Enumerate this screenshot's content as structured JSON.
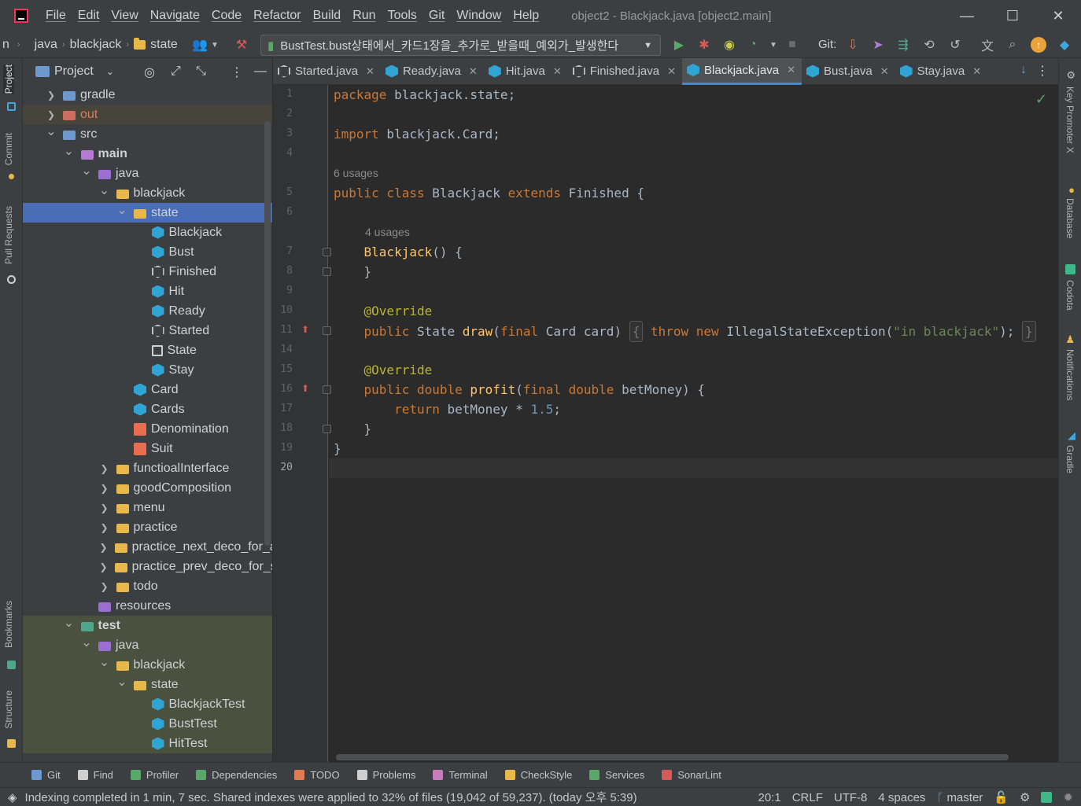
{
  "window": {
    "menu": [
      "File",
      "Edit",
      "View",
      "Navigate",
      "Code",
      "Refactor",
      "Build",
      "Run",
      "Tools",
      "Git",
      "Window",
      "Help"
    ],
    "title": "object2 - Blackjack.java [object2.main]",
    "minimize": "—",
    "maximize": "☐",
    "close": "✕"
  },
  "navbar": {
    "crumbs": [
      "n",
      "java",
      "blackjack",
      "state"
    ],
    "run_config": "BustTest.bust상태에서_카드1장을_추가로_받을때_예외가_발생한다",
    "git_label": "Git:"
  },
  "left_strip": {
    "tabs": [
      "Project",
      "Commit",
      "Pull Requests",
      "Bookmarks",
      "Structure"
    ]
  },
  "right_strip": {
    "tabs": [
      "Key Promoter X",
      "Database",
      "Codota",
      "Notifications",
      "Gradle"
    ]
  },
  "project_panel": {
    "title": "Project",
    "tree": [
      {
        "label": "gradle",
        "depth": 0,
        "arrow": "›",
        "icon": "folder-blue"
      },
      {
        "label": "out",
        "depth": 0,
        "arrow": "›",
        "icon": "folder-red",
        "state": "excluded"
      },
      {
        "label": "src",
        "depth": 0,
        "arrow": "⌄",
        "icon": "folder-blue"
      },
      {
        "label": "main",
        "depth": 1,
        "arrow": "⌄",
        "icon": "folder-main"
      },
      {
        "label": "java",
        "depth": 2,
        "arrow": "⌄",
        "icon": "folder-purple"
      },
      {
        "label": "blackjack",
        "depth": 3,
        "arrow": "⌄",
        "icon": "folder"
      },
      {
        "label": "state",
        "depth": 4,
        "arrow": "⌄",
        "icon": "folder",
        "state": "selected"
      },
      {
        "label": "Blackjack",
        "depth": 5,
        "arrow": "",
        "icon": "class"
      },
      {
        "label": "Bust",
        "depth": 5,
        "arrow": "",
        "icon": "class"
      },
      {
        "label": "Finished",
        "depth": 5,
        "arrow": "",
        "icon": "abstract"
      },
      {
        "label": "Hit",
        "depth": 5,
        "arrow": "",
        "icon": "class"
      },
      {
        "label": "Ready",
        "depth": 5,
        "arrow": "",
        "icon": "class"
      },
      {
        "label": "Started",
        "depth": 5,
        "arrow": "",
        "icon": "abstract"
      },
      {
        "label": "State",
        "depth": 5,
        "arrow": "",
        "icon": "interface"
      },
      {
        "label": "Stay",
        "depth": 5,
        "arrow": "",
        "icon": "class"
      },
      {
        "label": "Card",
        "depth": 4,
        "arrow": "",
        "icon": "class"
      },
      {
        "label": "Cards",
        "depth": 4,
        "arrow": "",
        "icon": "class"
      },
      {
        "label": "Denomination",
        "depth": 4,
        "arrow": "",
        "icon": "enum"
      },
      {
        "label": "Suit",
        "depth": 4,
        "arrow": "",
        "icon": "enum"
      },
      {
        "label": "functioalInterface",
        "depth": 3,
        "arrow": "›",
        "icon": "folder"
      },
      {
        "label": "goodComposition",
        "depth": 3,
        "arrow": "›",
        "icon": "folder"
      },
      {
        "label": "menu",
        "depth": 3,
        "arrow": "›",
        "icon": "folder"
      },
      {
        "label": "practice",
        "depth": 3,
        "arrow": "›",
        "icon": "folder"
      },
      {
        "label": "practice_next_deco_for_ad",
        "depth": 3,
        "arrow": "›",
        "icon": "folder"
      },
      {
        "label": "practice_prev_deco_for_se",
        "depth": 3,
        "arrow": "›",
        "icon": "folder"
      },
      {
        "label": "todo",
        "depth": 3,
        "arrow": "›",
        "icon": "folder"
      },
      {
        "label": "resources",
        "depth": 2,
        "arrow": "",
        "icon": "folder-purple"
      },
      {
        "label": "test",
        "depth": 1,
        "arrow": "⌄",
        "icon": "folder-green",
        "state": "test"
      },
      {
        "label": "java",
        "depth": 2,
        "arrow": "⌄",
        "icon": "folder-purple",
        "state": "test"
      },
      {
        "label": "blackjack",
        "depth": 3,
        "arrow": "⌄",
        "icon": "folder",
        "state": "test"
      },
      {
        "label": "state",
        "depth": 4,
        "arrow": "⌄",
        "icon": "folder",
        "state": "test"
      },
      {
        "label": "BlackjackTest",
        "depth": 5,
        "arrow": "",
        "icon": "class",
        "state": "test"
      },
      {
        "label": "BustTest",
        "depth": 5,
        "arrow": "",
        "icon": "class",
        "state": "test"
      },
      {
        "label": "HitTest",
        "depth": 5,
        "arrow": "",
        "icon": "class",
        "state": "test"
      }
    ]
  },
  "tabs": [
    {
      "label": "Started.java",
      "icon": "abstract",
      "active": false
    },
    {
      "label": "Ready.java",
      "icon": "class",
      "active": false
    },
    {
      "label": "Hit.java",
      "icon": "class",
      "active": false
    },
    {
      "label": "Finished.java",
      "icon": "abstract",
      "active": false
    },
    {
      "label": "Blackjack.java",
      "icon": "class",
      "active": true
    },
    {
      "label": "Bust.java",
      "icon": "class",
      "active": false
    },
    {
      "label": "Stay.java",
      "icon": "class",
      "active": false
    }
  ],
  "editor": {
    "lines": [
      {
        "n": "1",
        "html": "<span class='kw'>package</span> blackjack.state;"
      },
      {
        "n": "2",
        "html": ""
      },
      {
        "n": "3",
        "html": "<span class='kw'>import</span> blackjack.Card;"
      },
      {
        "n": "4",
        "html": ""
      },
      {
        "inlay": "6 usages"
      },
      {
        "n": "5",
        "html": "<span class='kw'>public class</span> Blackjack <span class='kw'>extends</span> Finished {"
      },
      {
        "n": "6",
        "html": ""
      },
      {
        "inlay": "4 usages",
        "indent": 1
      },
      {
        "n": "7",
        "html": "    <span class='fn'>Blackjack</span>() {"
      },
      {
        "n": "8",
        "html": "    }"
      },
      {
        "n": "9",
        "html": ""
      },
      {
        "n": "10",
        "html": "    <span class='ann'>@Override</span>"
      },
      {
        "n": "11",
        "html": "    <span class='kw'>public</span> State <span class='fn'>draw</span>(<span class='kw'>final</span> Card card) <span class='fold-box'>{</span> <span class='kw'>throw new</span> IllegalStateException(<span class='str'>\"in blackjack\"</span>); <span class='fold-box'>}</span>"
      },
      {
        "n": "14",
        "html": ""
      },
      {
        "n": "15",
        "html": "    <span class='ann'>@Override</span>"
      },
      {
        "n": "16",
        "html": "    <span class='kw'>public double</span> <span class='fn'>profit</span>(<span class='kw'>final double</span> betMoney) {"
      },
      {
        "n": "17",
        "html": "        <span class='kw'>return</span> betMoney * <span class='num'>1.5</span>;"
      },
      {
        "n": "18",
        "html": "    }"
      },
      {
        "n": "19",
        "html": "}"
      },
      {
        "n": "20",
        "html": "",
        "current": true
      }
    ]
  },
  "bottom_tools": [
    "Git",
    "Find",
    "Profiler",
    "Dependencies",
    "TODO",
    "Problems",
    "Terminal",
    "CheckStyle",
    "Services",
    "SonarLint"
  ],
  "status": {
    "message": "Indexing completed in 1 min, 7 sec. Shared indexes were applied to 32% of files (19,042 of 59,237). (today 오후 5:39)",
    "position": "20:1",
    "line_sep": "CRLF",
    "encoding": "UTF-8",
    "indent": "4 spaces",
    "branch": "master"
  }
}
